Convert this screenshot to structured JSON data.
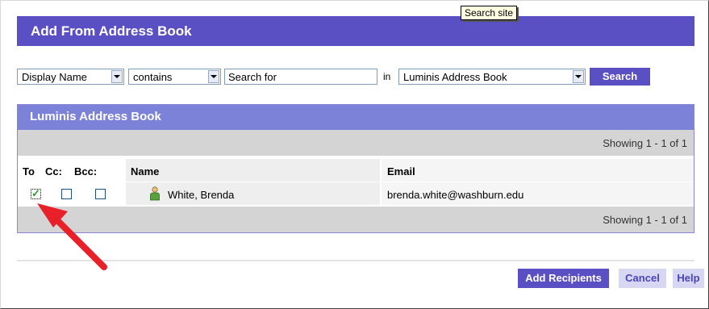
{
  "dialog": {
    "title": "Add From Address Book"
  },
  "tooltip": {
    "text": "Search site"
  },
  "search": {
    "field_select": "Display Name",
    "operator_select": "contains",
    "query_value": "Search for",
    "in_label": "in",
    "book_select": "Luminis Address Book",
    "search_button": "Search"
  },
  "address_book": {
    "title": "Luminis Address Book",
    "showing_top": "Showing 1 - 1  of  1",
    "showing_bottom": "Showing 1 - 1  of  1",
    "columns": {
      "to": "To",
      "cc": "Cc:",
      "bcc": "Bcc:",
      "name": "Name",
      "email": "Email"
    },
    "rows": [
      {
        "to_checked": true,
        "cc_checked": false,
        "bcc_checked": false,
        "name": "White, Brenda",
        "email": "brenda.white@washburn.edu",
        "icon": "person-icon"
      }
    ]
  },
  "footer": {
    "add_recipients": "Add Recipients",
    "cancel": "Cancel",
    "help": "Help"
  },
  "colors": {
    "title_bar": "#5b4fc4",
    "panel_header": "#7b82d8",
    "annotation_arrow": "#e8202a"
  }
}
